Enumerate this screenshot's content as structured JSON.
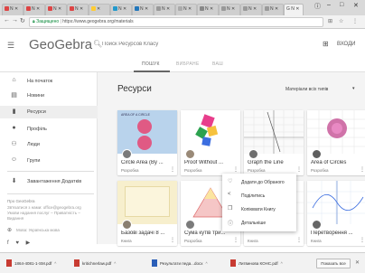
{
  "browser": {
    "tabs": [
      {
        "label": "N ✕",
        "color": "#d44"
      },
      {
        "label": "N ✕",
        "color": "#d44"
      },
      {
        "label": "N ✕",
        "color": "#d44"
      },
      {
        "label": "N ✕",
        "color": "#d44"
      },
      {
        "label": "✕",
        "color": "#fc3"
      },
      {
        "label": "N ✕",
        "color": "#29c"
      },
      {
        "label": "N ✕",
        "color": "#27b"
      },
      {
        "label": "N ✕",
        "color": "#999"
      },
      {
        "label": "N ✕",
        "color": "#aaa"
      },
      {
        "label": "N ✕",
        "color": "#888"
      },
      {
        "label": "N ✕",
        "color": "#999"
      },
      {
        "label": "N ✕",
        "color": "#999"
      },
      {
        "label": "N ✕",
        "color": "#999"
      }
    ],
    "active_tab": {
      "label": "G N ✕"
    },
    "address": {
      "secure": "Защищено",
      "url": "https://www.geogebra.org/materials"
    },
    "window": {
      "user": "ⓘ",
      "min": "–",
      "max": "□",
      "close": "✕"
    }
  },
  "header": {
    "logo": "GeoGebra",
    "search_placeholder": "Поиск Ресурсов Класу",
    "login": "ВХОДИ"
  },
  "subtabs": [
    "ПОШУК",
    "ВИБРАНЕ",
    "ВАШ"
  ],
  "sidebar": {
    "items": [
      {
        "label": "На початок",
        "icon": "home-icon"
      },
      {
        "label": "Новини",
        "icon": "news-icon"
      },
      {
        "label": "Ресурси",
        "icon": "resources-icon"
      },
      {
        "label": "Профіль",
        "icon": "profile-icon"
      },
      {
        "label": "Люди",
        "icon": "people-icon"
      },
      {
        "label": "Групи",
        "icon": "groups-icon"
      },
      {
        "label": "Завантаження Додатків",
        "icon": "download-icon"
      }
    ],
    "footer_title": "Про GeoGebra",
    "footer_lines": [
      "Зв'язатися з нами: office@geogebra.org",
      "Умови надання послуг – Приватність –",
      "Видання"
    ],
    "language": "Мова: Українська мова"
  },
  "main": {
    "title": "Ресурси",
    "filter": "Матеріали всіх типів",
    "cards": [
      {
        "title": "Circle Area (By ...",
        "type": "Розробка"
      },
      {
        "title": "Proof Without ...",
        "type": "Розробка"
      },
      {
        "title": "Graph the Line",
        "type": "Розробка"
      },
      {
        "title": "Area of Circles",
        "type": "Розробка"
      },
      {
        "title": "Базові задачі 8 ...",
        "type": "Книга"
      },
      {
        "title": "Сума кутів три...",
        "type": "Розробка"
      },
      {
        "title": "",
        "type": "Книга"
      },
      {
        "title": "Перетворення ...",
        "type": "Книга"
      }
    ],
    "card_thumb_label": "AREA OF A CIRCLE"
  },
  "popup": {
    "items": [
      {
        "label": "Додати до Обраного",
        "icon": "heart-icon"
      },
      {
        "label": "Поділитись",
        "icon": "share-icon"
      },
      {
        "label": "Копіювати Книгу",
        "icon": "copy-icon"
      },
      {
        "label": "Детальніше",
        "icon": "info-icon"
      }
    ]
  },
  "downloads": {
    "items": [
      "1864-4081-1-SM.pdf",
      "kritichnerlaw.pdf",
      "Результати педа...docx",
      "Литвинова КОНС.pdf"
    ],
    "show_all": "Показать все"
  }
}
